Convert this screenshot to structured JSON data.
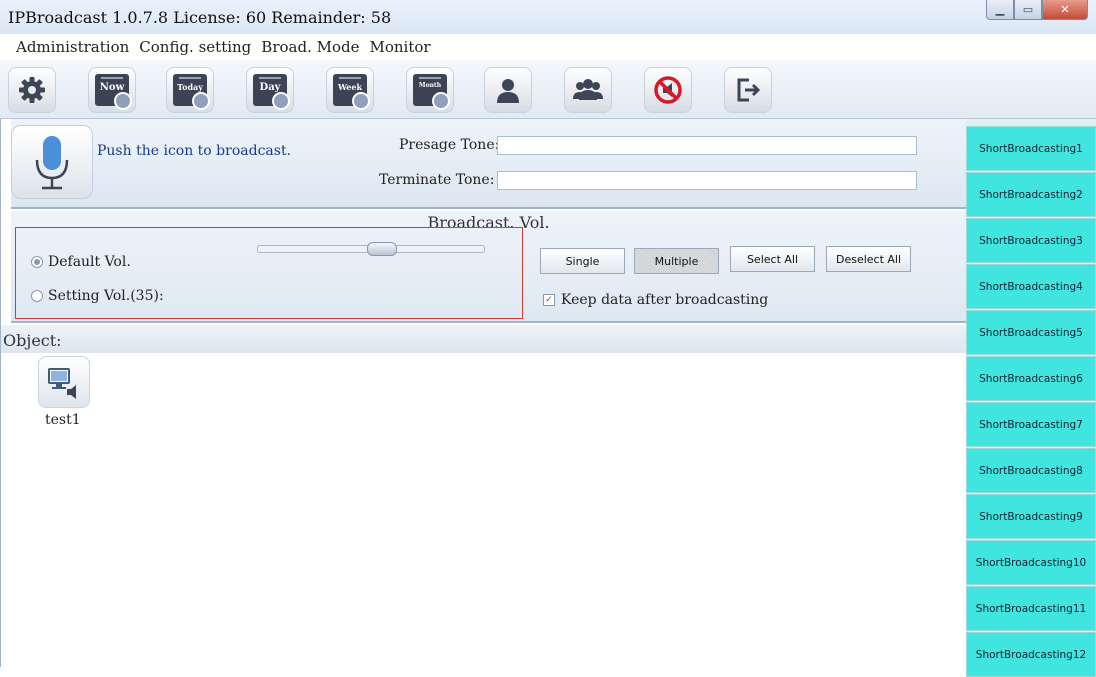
{
  "window": {
    "title": "IPBroadcast 1.0.7.8 License: 60 Remainder: 58",
    "controls": [
      "minimize-icon",
      "maximize-icon",
      "close-icon"
    ]
  },
  "menu": [
    "Administration",
    "Config. setting",
    "Broad. Mode",
    "Monitor"
  ],
  "toolbar": {
    "items": [
      {
        "icon": "gear-icon"
      },
      {
        "icon": "calendar-clock-icon",
        "label": "Now"
      },
      {
        "icon": "calendar-clock-icon",
        "label": "Today"
      },
      {
        "icon": "calendar-clock-icon",
        "label": "Day"
      },
      {
        "icon": "calendar-clock-icon",
        "label": "Week"
      },
      {
        "icon": "calendar-clock-icon",
        "label": "Month"
      },
      {
        "icon": "user-icon"
      },
      {
        "icon": "users-group-icon"
      },
      {
        "icon": "mute-icon"
      },
      {
        "icon": "exit-icon"
      }
    ]
  },
  "broadcast": {
    "push_text": "Push the icon to broadcast.",
    "presage_label": "Presage Tone:",
    "presage_value": "",
    "terminate_label": "Terminate Tone:",
    "terminate_value": ""
  },
  "volume": {
    "title": "Broadcast. Vol.",
    "default_label": "Default Vol.",
    "setting_label": "Setting Vol.(35):",
    "selected": "default",
    "slider_level": 0.48,
    "buttons": {
      "single": "Single",
      "multiple": "Multiple",
      "select_all": "Select All",
      "deselect_all": "Deselect All"
    },
    "keep_data_label": "Keep data after broadcasting",
    "keep_data_checked": true
  },
  "objects": {
    "label": "Object:",
    "items": [
      {
        "name": "test1",
        "icon": "speaker-terminal-icon"
      }
    ]
  },
  "sidebar": {
    "accent": "#40e5df",
    "items": [
      "ShortBroadcasting1",
      "ShortBroadcasting2",
      "ShortBroadcasting3",
      "ShortBroadcasting4",
      "ShortBroadcasting5",
      "ShortBroadcasting6",
      "ShortBroadcasting7",
      "ShortBroadcasting8",
      "ShortBroadcasting9",
      "ShortBroadcasting10",
      "ShortBroadcasting11",
      "ShortBroadcasting12"
    ]
  }
}
